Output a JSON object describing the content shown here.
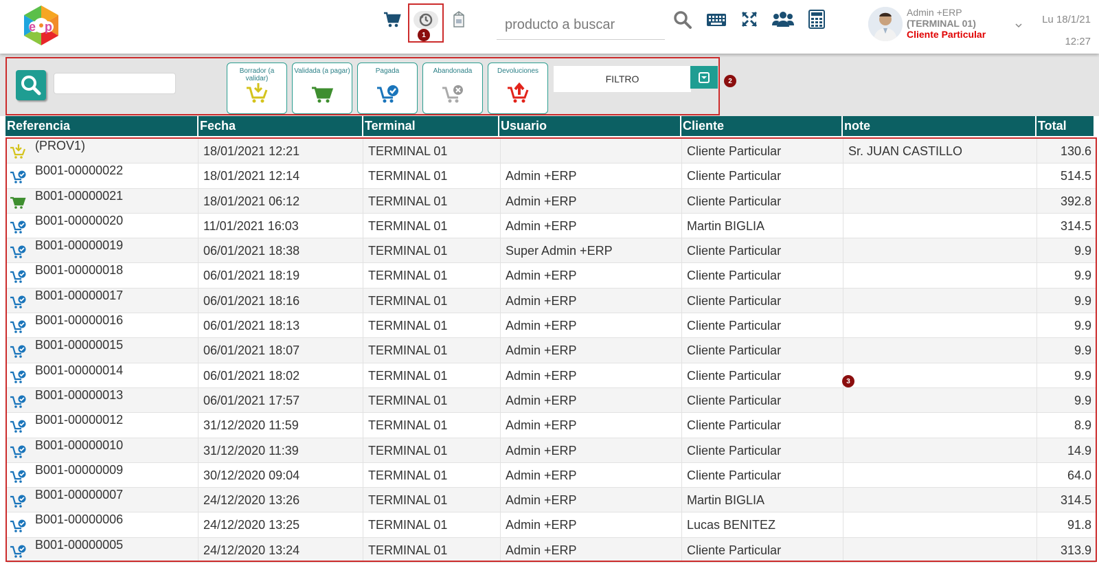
{
  "topbar": {
    "search_placeholder": "producto a buscar",
    "user": {
      "name": "Admin +ERP",
      "terminal": "(TERMINAL 01)",
      "client": "Cliente Particular"
    },
    "date": "Lu 18/1/21",
    "time": "12:27",
    "icons": [
      "cart-icon",
      "history-icon",
      "box-icon",
      "search-icon",
      "keyboard-icon",
      "expand-icon",
      "users-icon",
      "calculator-icon",
      "chevron-down-icon"
    ]
  },
  "badges": {
    "b1": "1",
    "b2": "2",
    "b3": "3"
  },
  "filters": {
    "search_value": "",
    "states": [
      {
        "label": "Borrador (a validar)",
        "icon": "cart-draft-icon"
      },
      {
        "label": "Validada (a pagar)",
        "icon": "cart-validated-icon"
      },
      {
        "label": "Pagada",
        "icon": "cart-paid-icon"
      },
      {
        "label": "Abandonada",
        "icon": "cart-abandoned-icon"
      },
      {
        "label": "Devoluciones",
        "icon": "cart-return-icon"
      }
    ],
    "filtro_label": "FILTRO"
  },
  "table": {
    "columns": [
      "Referencia",
      "Fecha",
      "Terminal",
      "Usuario",
      "Cliente",
      "note",
      "Total"
    ],
    "rows": [
      {
        "status": "draft",
        "ref": "(PROV1)",
        "fecha": "18/01/2021 12:21",
        "terminal": "TERMINAL 01",
        "usuario": "",
        "cliente": "Cliente Particular",
        "note": "Sr. JUAN CASTILLO",
        "total": "130.6"
      },
      {
        "status": "paid",
        "ref": "B001-00000022",
        "fecha": "18/01/2021 12:14",
        "terminal": "TERMINAL 01",
        "usuario": "Admin +ERP",
        "cliente": "Cliente Particular",
        "note": "",
        "total": "514.5"
      },
      {
        "status": "validated",
        "ref": "B001-00000021",
        "fecha": "18/01/2021 06:12",
        "terminal": "TERMINAL 01",
        "usuario": "Admin +ERP",
        "cliente": "Cliente Particular",
        "note": "",
        "total": "392.8"
      },
      {
        "status": "paid",
        "ref": "B001-00000020",
        "fecha": "11/01/2021 16:03",
        "terminal": "TERMINAL 01",
        "usuario": "Admin +ERP",
        "cliente": "Martin BIGLIA",
        "note": "",
        "total": "314.5"
      },
      {
        "status": "paid",
        "ref": "B001-00000019",
        "fecha": "06/01/2021 18:38",
        "terminal": "TERMINAL 01",
        "usuario": "Super Admin +ERP",
        "cliente": "Cliente Particular",
        "note": "",
        "total": "9.9"
      },
      {
        "status": "paid",
        "ref": "B001-00000018",
        "fecha": "06/01/2021 18:19",
        "terminal": "TERMINAL 01",
        "usuario": "Admin +ERP",
        "cliente": "Cliente Particular",
        "note": "",
        "total": "9.9"
      },
      {
        "status": "paid",
        "ref": "B001-00000017",
        "fecha": "06/01/2021 18:16",
        "terminal": "TERMINAL 01",
        "usuario": "Admin +ERP",
        "cliente": "Cliente Particular",
        "note": "",
        "total": "9.9"
      },
      {
        "status": "paid",
        "ref": "B001-00000016",
        "fecha": "06/01/2021 18:13",
        "terminal": "TERMINAL 01",
        "usuario": "Admin +ERP",
        "cliente": "Cliente Particular",
        "note": "",
        "total": "9.9"
      },
      {
        "status": "paid",
        "ref": "B001-00000015",
        "fecha": "06/01/2021 18:07",
        "terminal": "TERMINAL 01",
        "usuario": "Admin +ERP",
        "cliente": "Cliente Particular",
        "note": "",
        "total": "9.9"
      },
      {
        "status": "paid",
        "ref": "B001-00000014",
        "fecha": "06/01/2021 18:02",
        "terminal": "TERMINAL 01",
        "usuario": "Admin +ERP",
        "cliente": "Cliente Particular",
        "note": "",
        "total": "9.9"
      },
      {
        "status": "paid",
        "ref": "B001-00000013",
        "fecha": "06/01/2021 17:57",
        "terminal": "TERMINAL 01",
        "usuario": "Admin +ERP",
        "cliente": "Cliente Particular",
        "note": "",
        "total": "9.9"
      },
      {
        "status": "paid",
        "ref": "B001-00000012",
        "fecha": "31/12/2020 11:59",
        "terminal": "TERMINAL 01",
        "usuario": "Admin +ERP",
        "cliente": "Cliente Particular",
        "note": "",
        "total": "8.9"
      },
      {
        "status": "paid",
        "ref": "B001-00000010",
        "fecha": "31/12/2020 11:39",
        "terminal": "TERMINAL 01",
        "usuario": "Admin +ERP",
        "cliente": "Cliente Particular",
        "note": "",
        "total": "14.9"
      },
      {
        "status": "paid",
        "ref": "B001-00000009",
        "fecha": "30/12/2020 09:04",
        "terminal": "TERMINAL 01",
        "usuario": "Admin +ERP",
        "cliente": "Cliente Particular",
        "note": "",
        "total": "64.0"
      },
      {
        "status": "paid",
        "ref": "B001-00000007",
        "fecha": "24/12/2020 13:26",
        "terminal": "TERMINAL 01",
        "usuario": "Admin +ERP",
        "cliente": "Martin BIGLIA",
        "note": "",
        "total": "314.5"
      },
      {
        "status": "paid",
        "ref": "B001-00000006",
        "fecha": "24/12/2020 13:25",
        "terminal": "TERMINAL 01",
        "usuario": "Admin +ERP",
        "cliente": "Lucas BENITEZ",
        "note": "",
        "total": "91.8"
      },
      {
        "status": "paid",
        "ref": "B001-00000005",
        "fecha": "24/12/2020 13:24",
        "terminal": "TERMINAL 01",
        "usuario": "Admin +ERP",
        "cliente": "Cliente Particular",
        "note": "",
        "total": "313.9"
      }
    ]
  },
  "colors": {
    "teal": "#0c6063",
    "accent": "#1f9d92",
    "annotation": "#cc2b2b",
    "badge": "#8b0e0e",
    "client_red": "#e00000"
  }
}
